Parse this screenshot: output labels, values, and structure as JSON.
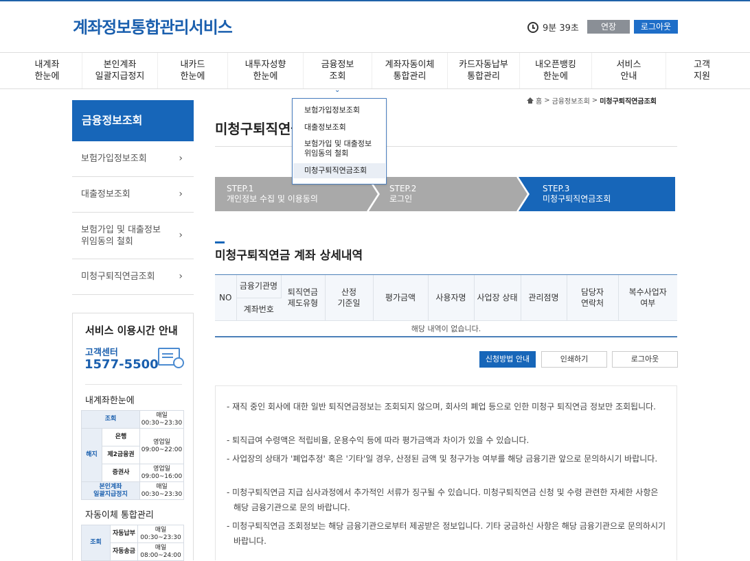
{
  "header": {
    "logo": "계좌정보통합관리서비스",
    "timer": "9분 39초",
    "extend_label": "연장",
    "logout_label": "로그아웃"
  },
  "gnb": [
    {
      "label": "내계좌\n한눈에"
    },
    {
      "label": "본인계좌\n일괄지급정지"
    },
    {
      "label": "내카드\n한눈에"
    },
    {
      "label": "내투자성향\n한눈에"
    },
    {
      "label": "금융정보\n조회"
    },
    {
      "label": "계좌자동이체\n통합관리"
    },
    {
      "label": "카드자동납부\n통합관리"
    },
    {
      "label": "내오픈뱅킹\n한눈에"
    },
    {
      "label": "서비스\n안내"
    },
    {
      "label": "고객\n지원"
    }
  ],
  "dropdown": [
    {
      "label": "보험가입정보조회"
    },
    {
      "label": "대출정보조회"
    },
    {
      "label": "보험가입 및 대출정보\n위임동의 철회"
    },
    {
      "label": "미청구퇴직연금조회"
    }
  ],
  "lnb": {
    "title": "금융정보조회",
    "items": [
      {
        "label": "보험가입정보조회"
      },
      {
        "label": "대출정보조회"
      },
      {
        "label": "보험가입 및 대출정보\n위임동의 철회"
      },
      {
        "label": "미청구퇴직연금조회"
      }
    ]
  },
  "service_hours": {
    "title": "서비스 이용시간 안내",
    "center_label": "고객센터",
    "phone": "1577-5500",
    "section1": "내계좌한눈에",
    "t1": {
      "r1c1": "조회",
      "r1c2": "매일\n00:30~23:30",
      "r2c0": "해지",
      "r2c1": "은행",
      "r2c2": "영업일\n09:00~22:00",
      "r3c1": "제2금융권",
      "r4c1": "증권사",
      "r4c2": "영업일\n09:00~16:00",
      "r5c1": "본인계좌\n일괄지급정지",
      "r5c2": "매일\n00:30~23:30"
    },
    "section2": "자동이체 통합관리",
    "t2": {
      "r1c0": "조회",
      "r1c1": "자동납부",
      "r1c2": "매일\n00:30~23:30",
      "r2c1": "자동송금",
      "r2c2": "매일\n08:00~24:00"
    }
  },
  "breadcrumb": {
    "home": "홈",
    "level1": "금융정보조회",
    "current": "미청구퇴직연금조회"
  },
  "page_title": "미청구퇴직연금조회",
  "steps": [
    {
      "num": "STEP.1",
      "label": "개인정보 수집 및 이용동의",
      "active": false
    },
    {
      "num": "STEP.2",
      "label": "로그인",
      "active": false
    },
    {
      "num": "STEP.3",
      "label": "미청구퇴직연금조회",
      "active": true
    }
  ],
  "section_title": "미청구퇴직연금 계좌 상세내역",
  "table": {
    "headers": {
      "no": "NO",
      "inst": "금융기관명",
      "acct": "계좌번호",
      "type": "퇴직연금\n제도유형",
      "base": "산정\n기준일",
      "amount": "평가금액",
      "employer": "사용자명",
      "status": "사업장 상태",
      "branch": "관리점명",
      "contact": "담당자\n연락처",
      "multi": "복수사업자\n여부"
    },
    "empty": "해당 내역이 없습니다."
  },
  "buttons": {
    "apply": "신청방법 안내",
    "print": "인쇄하기",
    "logout": "로그아웃"
  },
  "notes": [
    "- 재직 중인 회사에 대한 일반 퇴직연금정보는 조회되지 않으며, 회사의 폐업 등으로 인한 미청구 퇴직연금 정보만 조회됩니다.",
    "- 퇴직급여 수령액은 적립비율, 운용수익 등에 따라 평가금액과 차이가 있을 수 있습니다.",
    "- 사업장의 상태가 '폐업추정' 혹은 '기타'일 경우, 산정된 금액 및 청구가능 여부를 해당 금융기관 앞으로 문의하시기 바랍니다.",
    "- 미청구퇴직연금 지급 심사과정에서 추가적인 서류가 징구될 수 있습니다. 미청구퇴직연금 신청 및 수령 관련한 자세한 사항은 해당 금융기관으로 문의 바랍니다.",
    "- 미청구퇴직연금 조회정보는 해당 금융기관으로부터 제공받은 정보입니다. 기타 궁금하신 사항은 해당 금융기관으로 문의하시기 바랍니다."
  ]
}
